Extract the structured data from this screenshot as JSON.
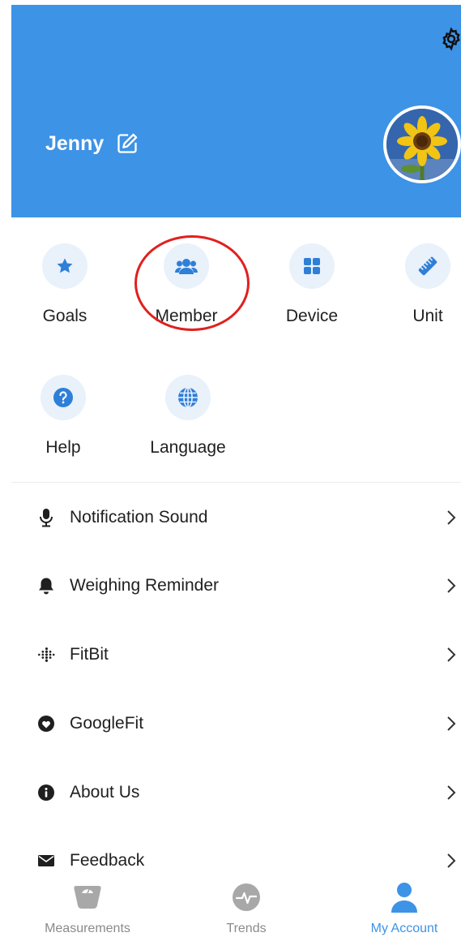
{
  "header": {
    "user_name": "Jenny",
    "background_color": "#3d93e6",
    "icons": {
      "settings": "gear-icon",
      "edit": "edit-icon",
      "avatar": "sunflower-avatar"
    }
  },
  "grid": {
    "items": [
      {
        "label": "Goals",
        "icon": "star-icon"
      },
      {
        "label": "Member",
        "icon": "members-icon"
      },
      {
        "label": "Device",
        "icon": "grid-icon"
      },
      {
        "label": "Unit",
        "icon": "ruler-icon"
      },
      {
        "label": "Help",
        "icon": "question-icon"
      },
      {
        "label": "Language",
        "icon": "globe-icon"
      }
    ]
  },
  "list": {
    "items": [
      {
        "label": "Notification Sound",
        "icon": "microphone-icon"
      },
      {
        "label": "Weighing Reminder",
        "icon": "bell-icon"
      },
      {
        "label": "FitBit",
        "icon": "fitbit-icon"
      },
      {
        "label": "GoogleFit",
        "icon": "googlefit-icon"
      },
      {
        "label": "About Us",
        "icon": "info-icon"
      },
      {
        "label": "Feedback",
        "icon": "envelope-icon"
      }
    ]
  },
  "bottom_nav": {
    "items": [
      {
        "label": "Measurements",
        "icon": "scale-icon",
        "active": false
      },
      {
        "label": "Trends",
        "icon": "pulse-icon",
        "active": false
      },
      {
        "label": "My Account",
        "icon": "person-icon",
        "active": true
      }
    ],
    "active_color": "#3d93e6",
    "inactive_color": "#8a8a8a"
  }
}
